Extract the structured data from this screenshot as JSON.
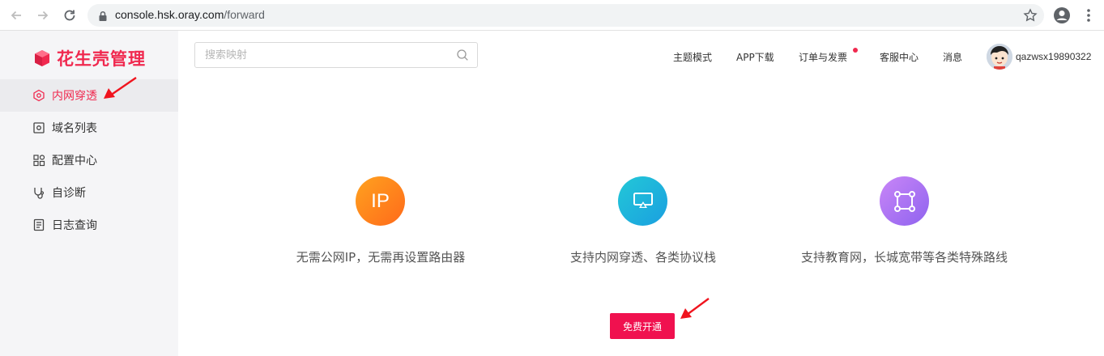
{
  "browser": {
    "url_host": "console.hsk.oray.com",
    "url_path": "/forward"
  },
  "app": {
    "logo_text": "花生壳管理",
    "brand_color": "#f0294f"
  },
  "sidebar": {
    "items": [
      {
        "label": "内网穿透",
        "icon": "tunnel-icon",
        "active": true
      },
      {
        "label": "域名列表",
        "icon": "domain-list-icon",
        "active": false
      },
      {
        "label": "配置中心",
        "icon": "grid-icon",
        "active": false
      },
      {
        "label": "自诊断",
        "icon": "diagnose-icon",
        "active": false
      },
      {
        "label": "日志查询",
        "icon": "log-icon",
        "active": false
      }
    ]
  },
  "header": {
    "search_placeholder": "搜索映射",
    "nav": [
      {
        "label": "主题模式"
      },
      {
        "label": "APP下载"
      },
      {
        "label": "订单与发票",
        "has_dot": true
      },
      {
        "label": "客服中心"
      },
      {
        "label": "消息"
      }
    ],
    "username": "qazwsx19890322"
  },
  "main": {
    "features": [
      {
        "icon_text": "IP",
        "text": "无需公网IP，无需再设置路由器"
      },
      {
        "icon": "screen-cast-icon",
        "text": "支持内网穿透、各类协议栈"
      },
      {
        "icon": "nodes-icon",
        "text": "支持教育网，长城宽带等各类特殊路线"
      }
    ],
    "cta_label": "免费开通"
  }
}
